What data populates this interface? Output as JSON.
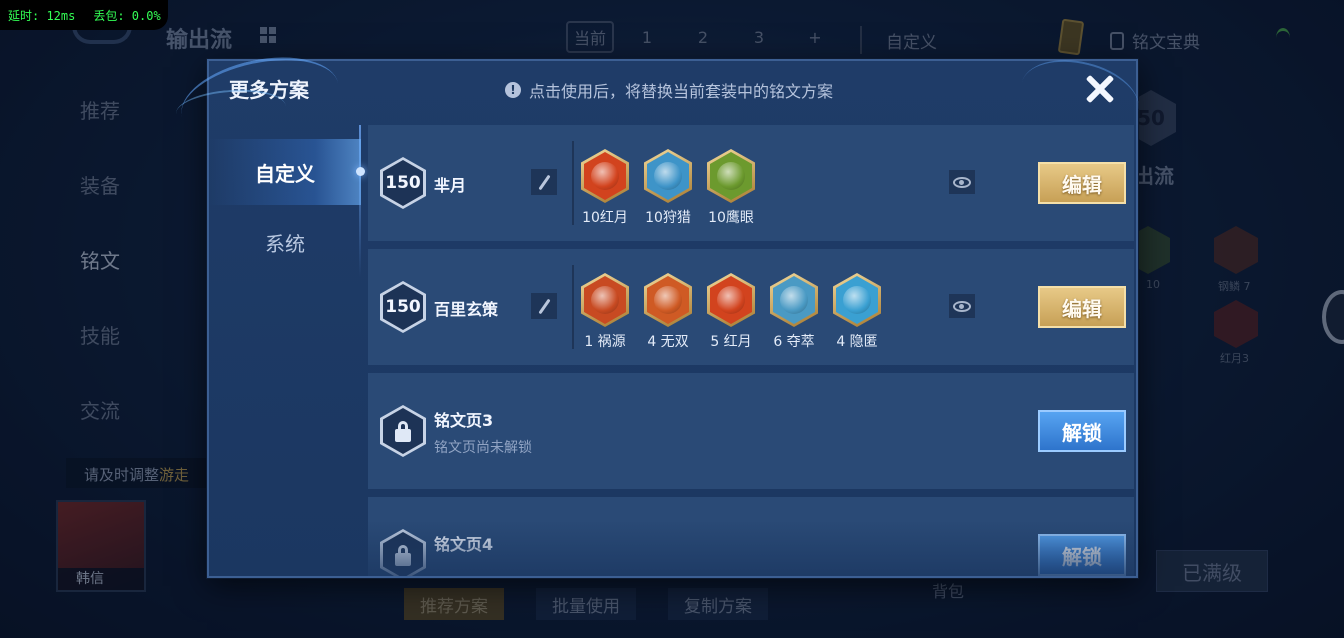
{
  "network": {
    "latency": "延时: 12ms",
    "loss": "丢包: 0.0%"
  },
  "background": {
    "title": "输出流",
    "page_tabs": [
      "当前",
      "1",
      "2",
      "3",
      "+"
    ],
    "custom_label": "自定义",
    "rune_book": "铭文宝典",
    "left_nav": [
      "推荐",
      "装备",
      "铭文",
      "技能",
      "交流"
    ],
    "hint": {
      "prefix": "请及时调整",
      "highlight": "游走"
    },
    "hero_name": "韩信",
    "bottom_buttons": [
      "推荐方案",
      "批量使用",
      "复制方案"
    ],
    "bag": "背包",
    "maxed": "已满级",
    "right_level": "50",
    "right_title": "出流",
    "right_labels": [
      "10",
      "钢鳞 7",
      "红月3"
    ]
  },
  "modal": {
    "title": "更多方案",
    "notice": "点击使用后，将替换当前套装中的铭文方案",
    "info_icon": "!",
    "side_tabs": [
      "自定义",
      "系统"
    ],
    "rows": [
      {
        "level": "150",
        "name": "芈月",
        "runes": [
          {
            "label": "10红月",
            "icon": "red-moon",
            "color": "#d2431e"
          },
          {
            "label": "10狩猎",
            "icon": "hunt",
            "color": "#3e94c8"
          },
          {
            "label": "10鹰眼",
            "icon": "hawk-eye",
            "color": "#6c9a2e"
          }
        ],
        "action": "编辑"
      },
      {
        "level": "150",
        "name": "百里玄策",
        "runes": [
          {
            "label": "1 祸源",
            "icon": "calamity",
            "color": "#c84a22"
          },
          {
            "label": "4 无双",
            "icon": "matchless",
            "color": "#cf5a24"
          },
          {
            "label": "5 红月",
            "icon": "red-moon",
            "color": "#d2431e"
          },
          {
            "label": "6 夺萃",
            "icon": "plunder",
            "color": "#4a9ac4"
          },
          {
            "label": "4 隐匿",
            "icon": "stealth",
            "color": "#3aa0d2"
          }
        ],
        "action": "编辑"
      },
      {
        "name": "铭文页3",
        "sub": "铭文页尚未解锁",
        "action": "解锁"
      },
      {
        "name": "铭文页4",
        "action": "解锁"
      }
    ]
  }
}
